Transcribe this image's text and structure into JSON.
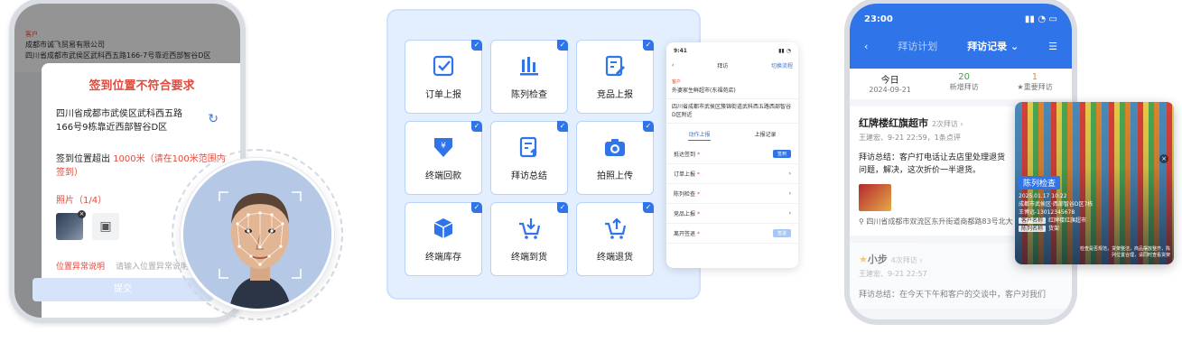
{
  "panel1": {
    "customer_label": "客户",
    "customer_name": "成都市诚飞贸易有限公司",
    "customer_address": "四川省成都市武侯区武科西五路166-7号靠近西部智谷D区",
    "sheet_title": "签到位置不符合要求",
    "sheet_address": "四川省成都市武侯区武科西五路166号9栋靠近西部智谷D区",
    "distance_label": "签到位置超出",
    "distance_value": "1000米（请在100米范围内签到）",
    "photos_label": "照片（1/4）",
    "reason_label": "位置异常说明",
    "reason_placeholder": "请输入位置异常说明",
    "submit_label": "提交"
  },
  "panel2": {
    "tiles": [
      {
        "label": "订单上报",
        "icon": "order-check-icon"
      },
      {
        "label": "陈列检查",
        "icon": "bar-chart-icon"
      },
      {
        "label": "竞品上报",
        "icon": "edit-document-icon"
      },
      {
        "label": "终端回款",
        "icon": "yuan-down-icon"
      },
      {
        "label": "拜访总结",
        "icon": "document-upload-icon"
      },
      {
        "label": "拍照上传",
        "icon": "camera-icon"
      },
      {
        "label": "终端库存",
        "icon": "box-icon"
      },
      {
        "label": "终端到货",
        "icon": "cart-down-icon"
      },
      {
        "label": "终端退货",
        "icon": "cart-up-icon"
      }
    ],
    "mini": {
      "time": "9:41",
      "title": "拜访",
      "switch_label": "切换流程",
      "customer_label": "客户",
      "customer_name": "外婆家生鲜超市(东福苑店)",
      "address": "四川省成都市武侯区簇锦街道武科西五路西部智谷D区附近",
      "tab_active": "动作上报",
      "tab_other": "上报记录",
      "rows": [
        {
          "label": "抵达签到",
          "action": "签到"
        },
        {
          "label": "订单上报",
          "action": "›"
        },
        {
          "label": "陈列检查",
          "action": "›"
        },
        {
          "label": "竞品上报",
          "action": "›"
        },
        {
          "label": "离开签退",
          "action": "签退"
        }
      ]
    }
  },
  "panel3": {
    "time": "23:00",
    "tab_plan": "拜访计划",
    "tab_record": "拜访记录",
    "stats": [
      {
        "value": "今日",
        "sub": "2024-09-21",
        "color": "default"
      },
      {
        "value": "20",
        "sub": "新增拜访",
        "color": "green"
      },
      {
        "value": "1",
        "sub": "★重要拜访",
        "color": "orange"
      }
    ],
    "record1": {
      "name": "红牌楼红旗超市",
      "count": "2次拜访 ›",
      "meta": "王建宏、9-21 22:59，1条点评",
      "summary": "拜访总结：客户打电话让去店里处理退货问题，解决，这次折价一半退货。",
      "address": "四川省成都市双流区东升街道商都路83号北大"
    },
    "record2": {
      "name": "小步",
      "count": "4次拜访 ›",
      "meta": "王建宏、9-21 22:57",
      "summary": "拜访总结：在今天下午和客户的交谈中，客户对我们"
    },
    "photo_card": {
      "tag": "陈列检查",
      "datetime": "2025.01.17 10:22",
      "location": "成都市武侯区·西部智谷D区7栋",
      "person": "王博远-13012345678",
      "chip1": "客户名称",
      "chip1_value": "红牌楼红旗超市",
      "chip2": "陈列名称",
      "chip2_value": "货架",
      "footer": "检查是否规范，货架整洁，商品摆放整齐，陈列位置合理，请同时查看货架"
    }
  }
}
